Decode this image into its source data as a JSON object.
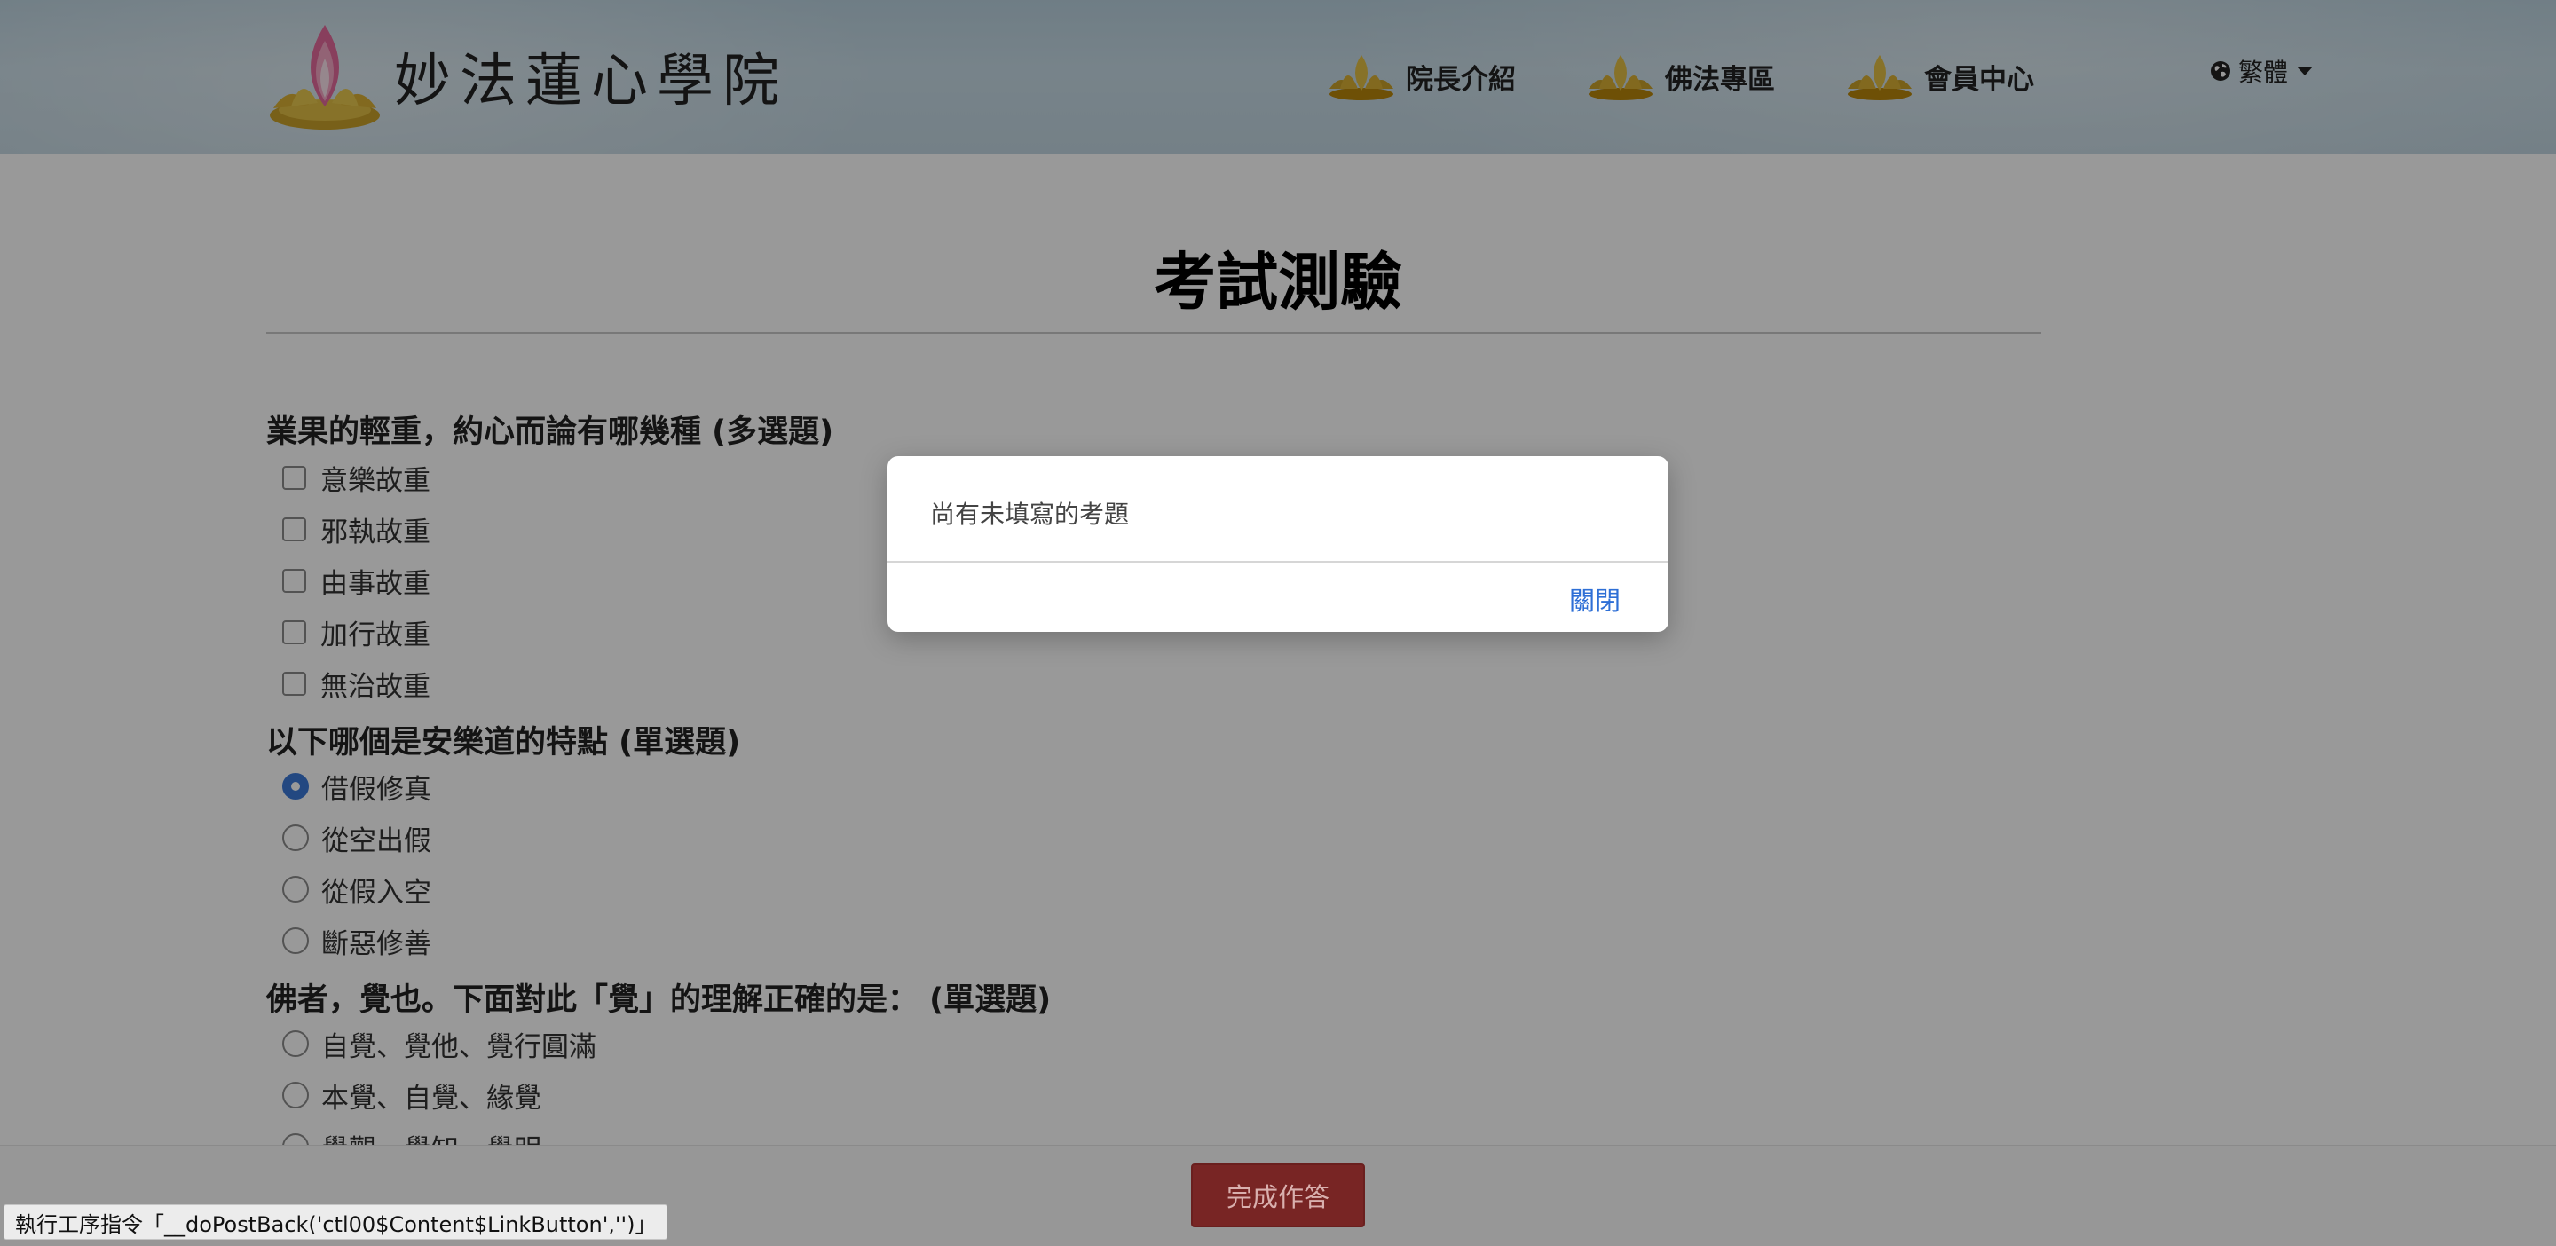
{
  "header": {
    "site_title": "妙法蓮心學院",
    "nav": [
      {
        "label": "院長介紹",
        "icon": "lotus-icon"
      },
      {
        "label": "佛法專區",
        "icon": "lotus-icon"
      },
      {
        "label": "會員中心",
        "icon": "lotus-icon"
      }
    ],
    "language": {
      "label": "繁體",
      "icon": "globe-icon"
    }
  },
  "page": {
    "title": "考試測驗"
  },
  "questions": [
    {
      "text": "業果的輕重，約心而論有哪幾種 (多選題)",
      "type": "checkbox",
      "options": [
        {
          "label": "意樂故重",
          "checked": false
        },
        {
          "label": "邪執故重",
          "checked": false
        },
        {
          "label": "由事故重",
          "checked": false
        },
        {
          "label": "加行故重",
          "checked": false
        },
        {
          "label": "無治故重",
          "checked": false
        }
      ]
    },
    {
      "text": "以下哪個是安樂道的特點 (單選題)",
      "type": "radio",
      "options": [
        {
          "label": "借假修真",
          "checked": true
        },
        {
          "label": "從空出假",
          "checked": false
        },
        {
          "label": "從假入空",
          "checked": false
        },
        {
          "label": "斷惡修善",
          "checked": false
        }
      ]
    },
    {
      "text": "佛者，覺也。下面對此「覺」的理解正確的是： (單選題)",
      "type": "radio",
      "options": [
        {
          "label": "自覺、覺他、覺行圓滿",
          "checked": false
        },
        {
          "label": "本覺、自覺、緣覺",
          "checked": false
        },
        {
          "label": "覺觀、覺知、覺明",
          "checked": false
        }
      ]
    }
  ],
  "footer": {
    "submit_label": "完成作答"
  },
  "status_bar": {
    "text": "執行工序指令「__doPostBack('ctl00$Content$LinkButton','')」"
  },
  "modal": {
    "message": "尚有未填寫的考題",
    "close_label": "關閉"
  },
  "colors": {
    "accent_blue": "#2e6fd6",
    "submit_red": "#782524",
    "header_blue": "#c2d6e1",
    "lotus_gold": "#c9a12a"
  }
}
